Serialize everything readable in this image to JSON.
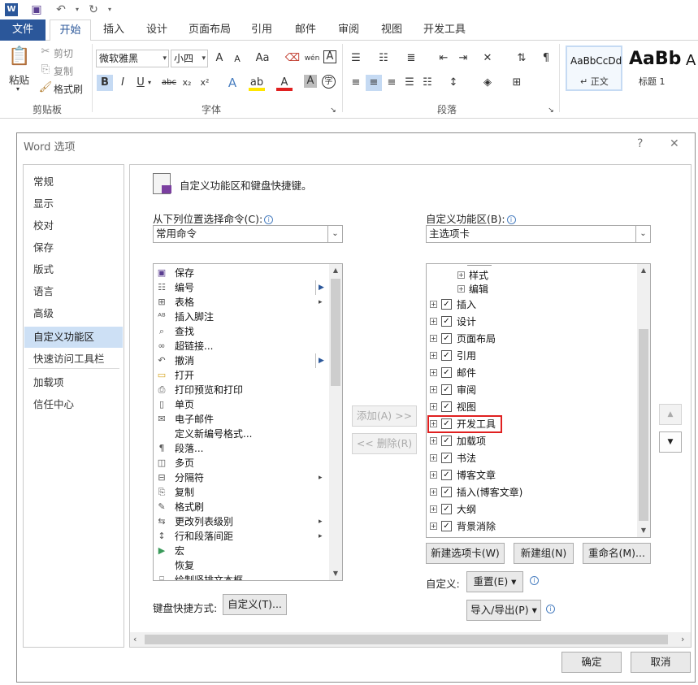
{
  "quick_access": {
    "icons": [
      "word-logo-icon",
      "save-icon",
      "undo-icon",
      "undo-dropdown-icon",
      "redo-icon",
      "redo-dropdown-icon"
    ]
  },
  "tabs": {
    "file": "文件",
    "home": "开始",
    "insert": "插入",
    "design": "设计",
    "layout": "页面布局",
    "references": "引用",
    "mailings": "邮件",
    "review": "审阅",
    "view": "视图",
    "developer": "开发工具"
  },
  "ribbon": {
    "clipboard": {
      "paste": "粘贴",
      "cut": "剪切",
      "copy": "复制",
      "format_painter": "格式刷",
      "label": "剪贴板"
    },
    "font": {
      "name": "微软雅黑",
      "size": "小四",
      "label": "字体",
      "change_case": "Aa",
      "bold": "B",
      "italic": "I",
      "underline": "U",
      "strike": "abc",
      "sub": "x₂",
      "sup": "x²",
      "char_shade": "A",
      "clear_fmt": "A",
      "phonetic": "wén",
      "border": "A"
    },
    "paragraph": {
      "label": "段落"
    },
    "styles": {
      "normal_preview": "AaBbCcDd",
      "normal": "↵ 正文",
      "heading1_preview": "AaBb",
      "heading1": "标题 1",
      "next_preview": "A"
    }
  },
  "dialog": {
    "title": "Word 选项",
    "help": "?",
    "close": "✕",
    "nav": [
      "常规",
      "显示",
      "校对",
      "保存",
      "版式",
      "语言",
      "高级",
      "自定义功能区",
      "快速访问工具栏",
      "加载项",
      "信任中心"
    ],
    "nav_selected": 7,
    "header": "自定义功能区和键盘快捷键。",
    "left_label": "从下列位置选择命令(C):",
    "left_combo": "常用命令",
    "right_label": "自定义功能区(B):",
    "right_combo": "主选项卡",
    "commands": [
      {
        "icon": "save-icon",
        "label": "保存"
      },
      {
        "icon": "numbering-icon",
        "label": "编号",
        "sub": "separator"
      },
      {
        "icon": "table-icon",
        "label": "表格",
        "sub": "arrow"
      },
      {
        "icon": "insert-footnote-icon",
        "label": "插入脚注"
      },
      {
        "icon": "find-icon",
        "label": "查找"
      },
      {
        "icon": "hyperlink-icon",
        "label": "超链接..."
      },
      {
        "icon": "undo-icon",
        "label": "撤消",
        "sub": "separator"
      },
      {
        "icon": "open-folder-icon",
        "label": "打开"
      },
      {
        "icon": "print-preview-icon",
        "label": "打印预览和打印"
      },
      {
        "icon": "single-page-icon",
        "label": "单页"
      },
      {
        "icon": "email-icon",
        "label": "电子邮件"
      },
      {
        "icon": "",
        "label": "定义新编号格式..."
      },
      {
        "icon": "paragraph-icon",
        "label": "段落..."
      },
      {
        "icon": "multi-page-icon",
        "label": "多页"
      },
      {
        "icon": "page-break-icon",
        "label": "分隔符",
        "sub": "arrow"
      },
      {
        "icon": "copy-icon",
        "label": "复制"
      },
      {
        "icon": "format-painter-icon",
        "label": "格式刷"
      },
      {
        "icon": "list-level-icon",
        "label": "更改列表级别",
        "sub": "arrow"
      },
      {
        "icon": "line-spacing-icon",
        "label": "行和段落间距",
        "sub": "arrow"
      },
      {
        "icon": "macro-icon",
        "label": "宏"
      },
      {
        "icon": "",
        "label": "恢复"
      },
      {
        "icon": "vertical-textbox-icon",
        "label": "绘制竖排文本框"
      }
    ],
    "tree": [
      {
        "level": 2,
        "label": "样式",
        "checkbox": false
      },
      {
        "level": 2,
        "label": "编辑",
        "checkbox": false
      },
      {
        "level": 1,
        "label": "插入",
        "checkbox": true
      },
      {
        "level": 1,
        "label": "设计",
        "checkbox": true
      },
      {
        "level": 1,
        "label": "页面布局",
        "checkbox": true
      },
      {
        "level": 1,
        "label": "引用",
        "checkbox": true
      },
      {
        "level": 1,
        "label": "邮件",
        "checkbox": true
      },
      {
        "level": 1,
        "label": "审阅",
        "checkbox": true
      },
      {
        "level": 1,
        "label": "视图",
        "checkbox": true
      },
      {
        "level": 1,
        "label": "开发工具",
        "checkbox": true,
        "highlight": true
      },
      {
        "level": 1,
        "label": "加载项",
        "checkbox": true
      },
      {
        "level": 1,
        "label": "书法",
        "checkbox": true
      },
      {
        "level": 1,
        "label": "博客文章",
        "checkbox": true
      },
      {
        "level": 1,
        "label": "插入(博客文章)",
        "checkbox": true
      },
      {
        "level": 1,
        "label": "大纲",
        "checkbox": true
      },
      {
        "level": 1,
        "label": "背景消除",
        "checkbox": true
      }
    ],
    "add_btn": "添加(A) >>",
    "remove_btn": "<< 删除(R)",
    "new_tab": "新建选项卡(W)",
    "new_group": "新建组(N)",
    "rename": "重命名(M)...",
    "customize_label": "自定义:",
    "reset": "重置(E) ▾",
    "import_export": "导入/导出(P) ▾",
    "keyboard_label": "键盘快捷方式:",
    "keyboard_btn": "自定义(T)...",
    "ok": "确定",
    "cancel": "取消"
  }
}
